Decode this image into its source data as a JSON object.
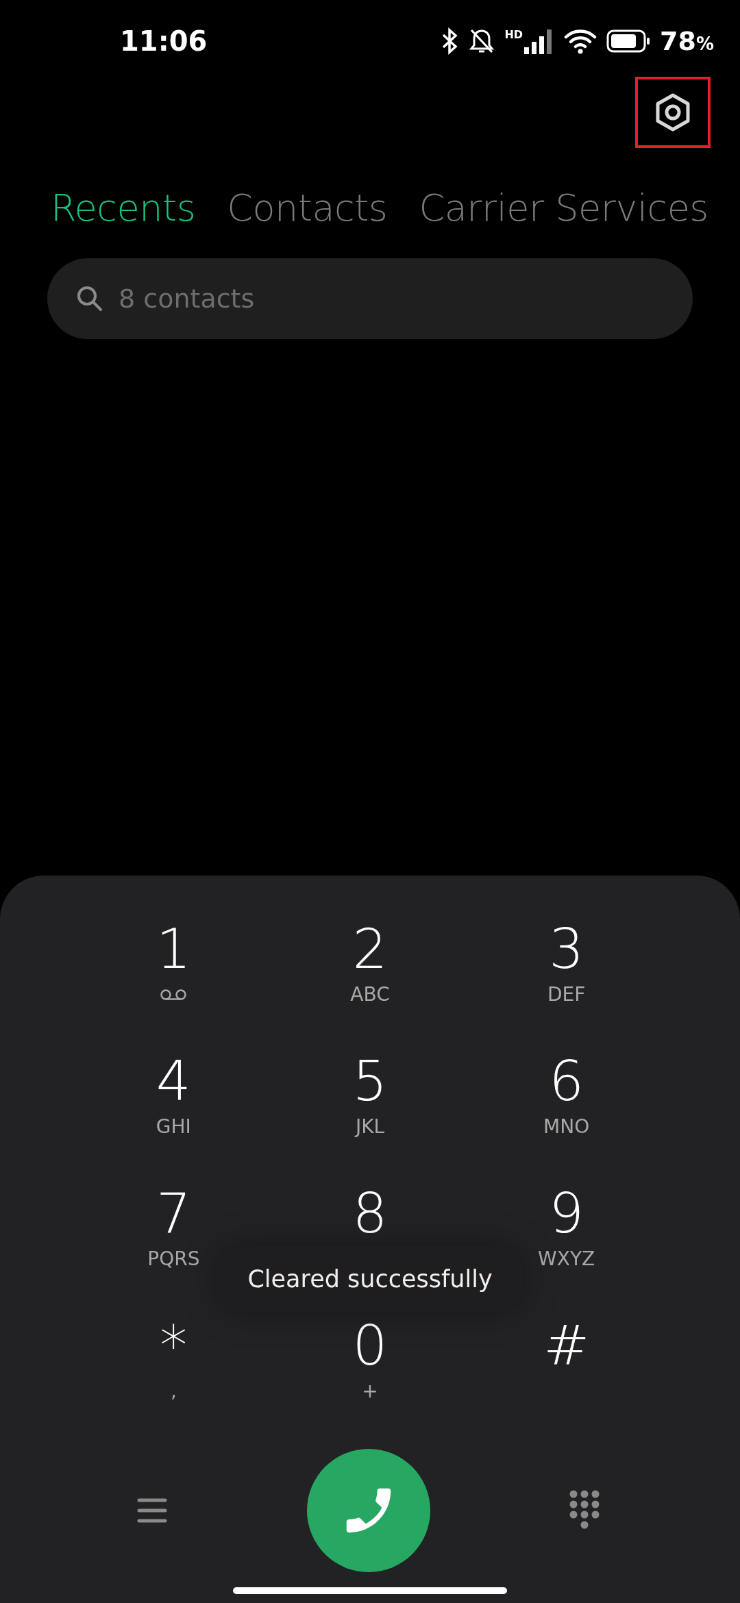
{
  "status_bar": {
    "time": "11:06",
    "network_label": "HD",
    "battery": "78",
    "battery_unit": "%"
  },
  "settings_button": {
    "highlighted": true
  },
  "tabs": [
    {
      "label": "Recents",
      "selected": true
    },
    {
      "label": "Contacts",
      "selected": false
    },
    {
      "label": "Carrier Services",
      "selected": false
    }
  ],
  "search": {
    "placeholder": "8 contacts"
  },
  "keypad": [
    {
      "digit": "1",
      "kind": "voicemail"
    },
    {
      "digit": "2",
      "kind": "letters",
      "letters": "ABC"
    },
    {
      "digit": "3",
      "kind": "letters",
      "letters": "DEF"
    },
    {
      "digit": "4",
      "kind": "letters",
      "letters": "GHI"
    },
    {
      "digit": "5",
      "kind": "letters",
      "letters": "JKL"
    },
    {
      "digit": "6",
      "kind": "letters",
      "letters": "MNO"
    },
    {
      "digit": "7",
      "kind": "letters",
      "letters": "PQRS"
    },
    {
      "digit": "8",
      "kind": "plain"
    },
    {
      "digit": "9",
      "kind": "letters",
      "letters": "WXYZ"
    },
    {
      "digit": "*",
      "kind": "letters",
      "letters": ","
    },
    {
      "digit": "0",
      "kind": "letters",
      "letters": "+"
    },
    {
      "digit": "#",
      "kind": "plain"
    }
  ],
  "toast": "Cleared successfully"
}
